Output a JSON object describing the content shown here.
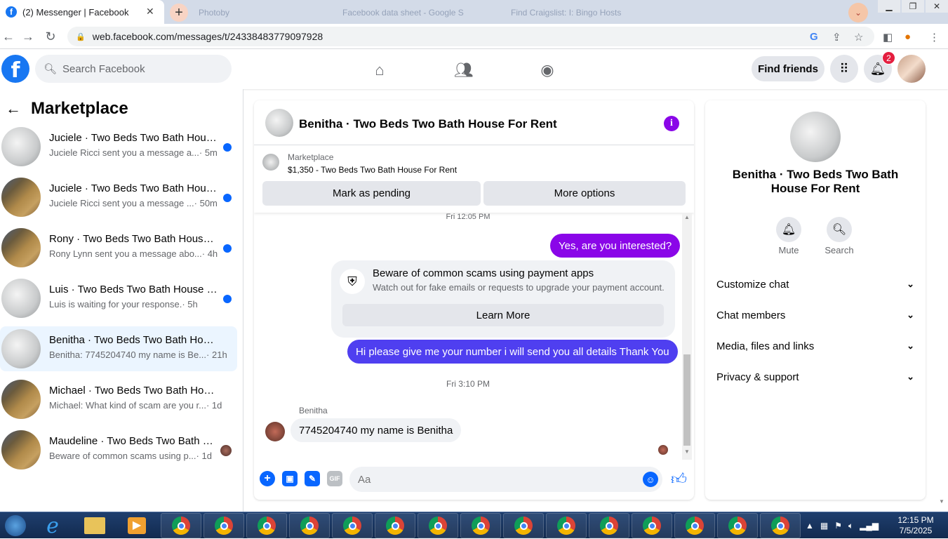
{
  "browser": {
    "active_tab_title": "(2) Messenger | Facebook",
    "bg_tabs": [
      "Photoby",
      "Facebook data sheet - Google S",
      "Find Craigslist: I: Bingo Hosts"
    ],
    "url": "web.facebook.com/messages/t/24338483779097928",
    "overlay_hint": "facebook.com"
  },
  "fb": {
    "search_placeholder": "Search Facebook",
    "find_friends": "Find friends",
    "notification_count": "2"
  },
  "sidebar": {
    "title": "Marketplace",
    "conversations": [
      {
        "name": "Juciele · Two Beds Two Bath House For Rent",
        "snippet": "Juciele Ricci sent you a message a...",
        "time": " · 5m",
        "unread": true,
        "avatar": "white"
      },
      {
        "name": "Juciele · Two Beds Two Bath House For Rent",
        "snippet": "Juciele Ricci sent you a message ...",
        "time": " · 50m",
        "unread": true,
        "avatar": "brown"
      },
      {
        "name": "Rony · Two Beds Two Bath House For Rent",
        "snippet": "Rony Lynn sent you a message abo...",
        "time": " · 4h",
        "unread": true,
        "avatar": "brown"
      },
      {
        "name": "Luis · Two Beds Two Bath House For Rent",
        "snippet": "Luis is waiting for your response.",
        "time": " · 5h",
        "unread": true,
        "avatar": "white"
      },
      {
        "name": "Benitha · Two Beds Two Bath House For Rent",
        "snippet": "Benitha: 7745204740 my name is Be...",
        "time": " · 21h",
        "unread": false,
        "avatar": "white"
      },
      {
        "name": "Michael · Two Beds Two Bath House For Rent",
        "snippet": "Michael: What kind of scam are you r...",
        "time": " · 1d",
        "unread": false,
        "avatar": "brown"
      },
      {
        "name": "Maudeline · Two Beds Two Bath House For Rent",
        "snippet": "Beware of common scams using p...",
        "time": " · 1d",
        "unread": false,
        "avatar": "brown"
      }
    ]
  },
  "chat": {
    "title": "Benitha · Two Beds Two Bath House For Rent",
    "listing_source": "Marketplace",
    "listing_desc": "$1,350 - Two Beds Two Bath House For Rent",
    "mark_pending": "Mark as pending",
    "more_options": "More options",
    "timestamp1": "Fri 12:05 PM",
    "msg_out1": "Yes, are you interested?",
    "scam_title": "Beware of common scams using payment apps",
    "scam_text": "Watch out for fake emails or requests to upgrade your payment account.",
    "learn_more": "Learn More",
    "msg_out2": "Hi please give me your number i will send you all details Thank You",
    "timestamp2": "Fri 3:10 PM",
    "sender_name": "Benitha",
    "msg_in1": "7745204740 my name is Benitha",
    "input_placeholder": "Aa",
    "gif_label": "GIF"
  },
  "right_panel": {
    "name": "Benitha · Two Beds Two Bath House For Rent",
    "mute": "Mute",
    "search": "Search",
    "sections": [
      "Customize chat",
      "Chat members",
      "Media, files and links",
      "Privacy & support"
    ]
  },
  "taskbar": {
    "time": "12:15 PM",
    "date": "7/5/2025"
  },
  "colors": {
    "facebook_blue": "#1877f2",
    "outgoing_purple": "#8a06e8",
    "outgoing_blue_purple": "#4f3ff0",
    "unread_dot": "#0866ff"
  }
}
